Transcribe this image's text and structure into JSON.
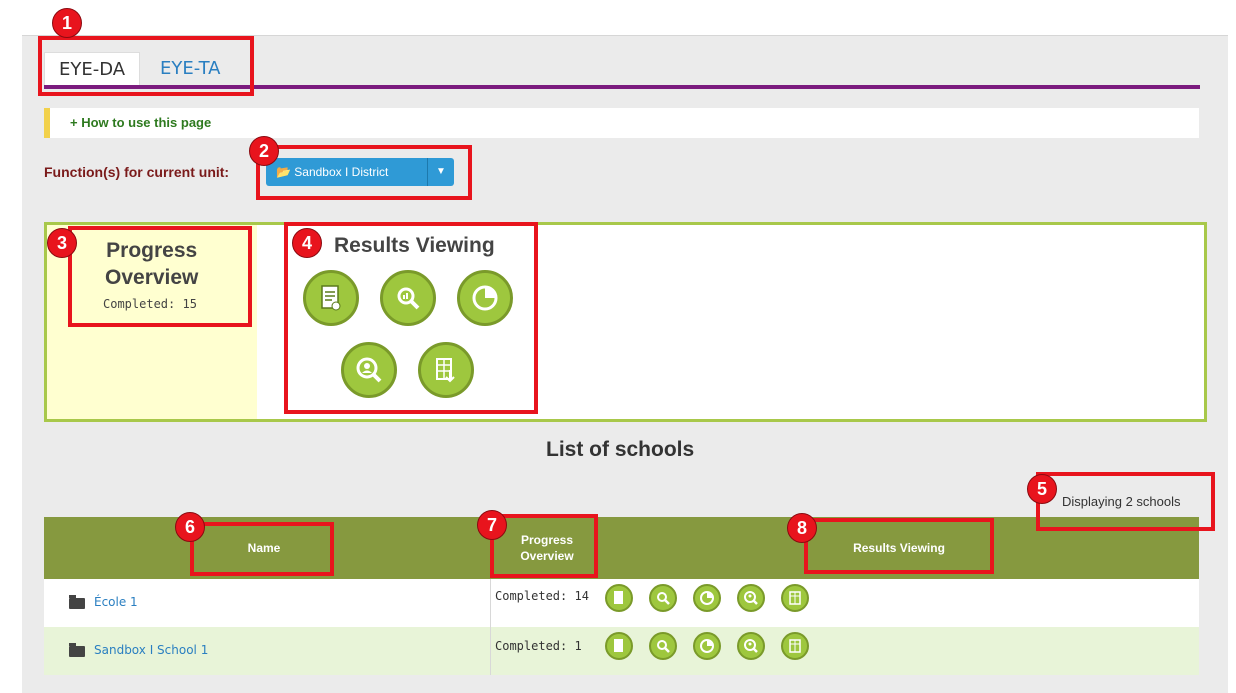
{
  "tabs": [
    {
      "label": "EYE-DA",
      "active": true
    },
    {
      "label": "EYE-TA",
      "active": false
    }
  ],
  "help": {
    "text": "+ How to use this page"
  },
  "function": {
    "label": "Function(s) for current unit:",
    "button_label": "Sandbox I District"
  },
  "progress_overview": {
    "title_line1": "Progress",
    "title_line2": "Overview",
    "completed": "Completed: 15"
  },
  "results_viewing": {
    "title": "Results Viewing",
    "icons": [
      "report-icon",
      "search-chart-icon",
      "pie-chart-icon",
      "user-search-icon",
      "table-download-icon"
    ]
  },
  "list": {
    "title": "List of schools",
    "count_text": "Displaying 2 schools"
  },
  "table": {
    "headers": {
      "name": "Name",
      "progress_line1": "Progress",
      "progress_line2": "Overview",
      "results": "Results Viewing"
    },
    "rows": [
      {
        "name": "École 1",
        "progress": "Completed: 14"
      },
      {
        "name": "Sandbox I School 1",
        "progress": "Completed: 1"
      }
    ]
  },
  "annotations": [
    "1",
    "2",
    "3",
    "4",
    "5",
    "6",
    "7",
    "8"
  ],
  "colors": {
    "accent": "#7b1b7e",
    "annotation": "#e8141d",
    "header_green": "#86993f",
    "icon_green": "#9ec73e",
    "button_blue": "#2f9ad6"
  }
}
